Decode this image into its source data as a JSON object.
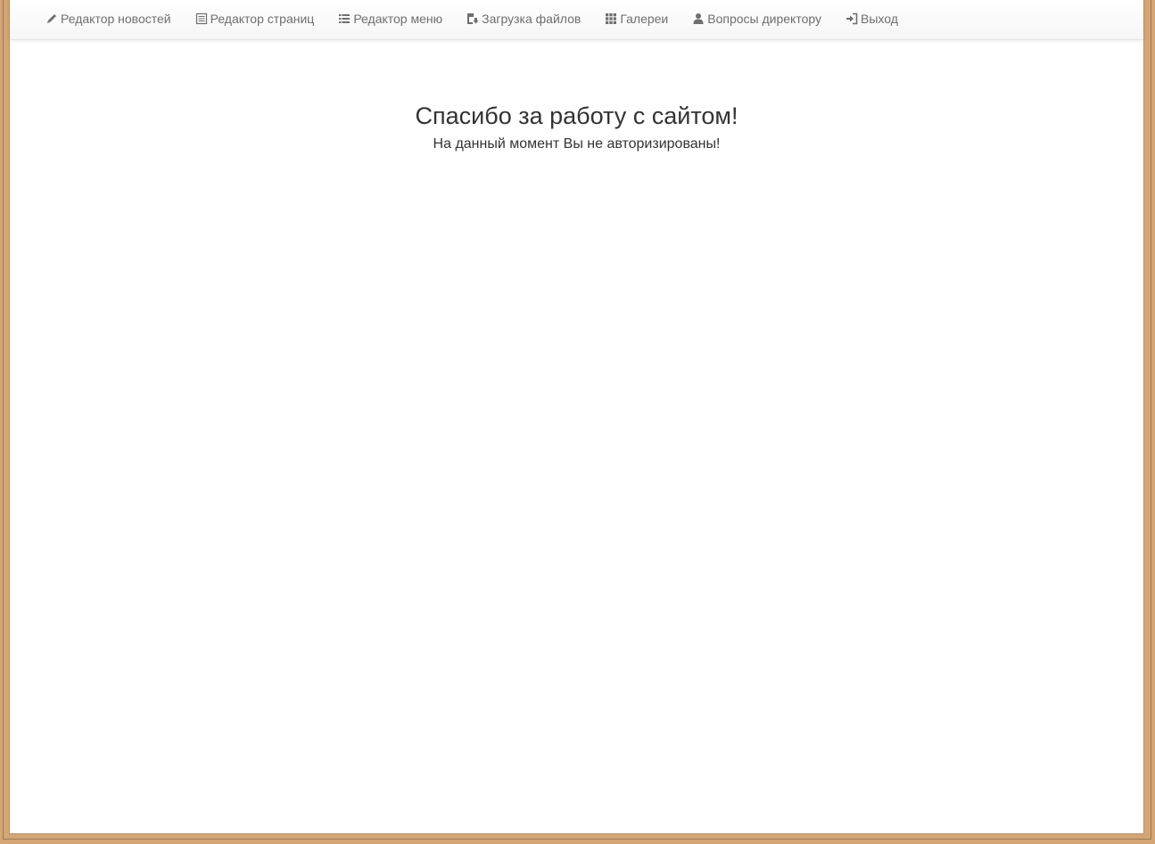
{
  "nav": {
    "items": [
      {
        "label": "Редактор новостей",
        "icon": "pencil-icon"
      },
      {
        "label": "Редактор страниц",
        "icon": "list-alt-icon"
      },
      {
        "label": "Редактор меню",
        "icon": "list-icon"
      },
      {
        "label": "Загрузка файлов",
        "icon": "floppy-save-icon"
      },
      {
        "label": "Галереи",
        "icon": "th-icon"
      },
      {
        "label": "Вопросы директору",
        "icon": "user-icon"
      },
      {
        "label": "Выход",
        "icon": "log-in-icon"
      }
    ]
  },
  "main": {
    "title": "Спасибо за работу с сайтом!",
    "subtitle": "На данный момент Вы не авторизированы!"
  },
  "colors": {
    "frame": "#d4a676",
    "nav_text": "#6e6e6e",
    "body_text": "#333333"
  }
}
